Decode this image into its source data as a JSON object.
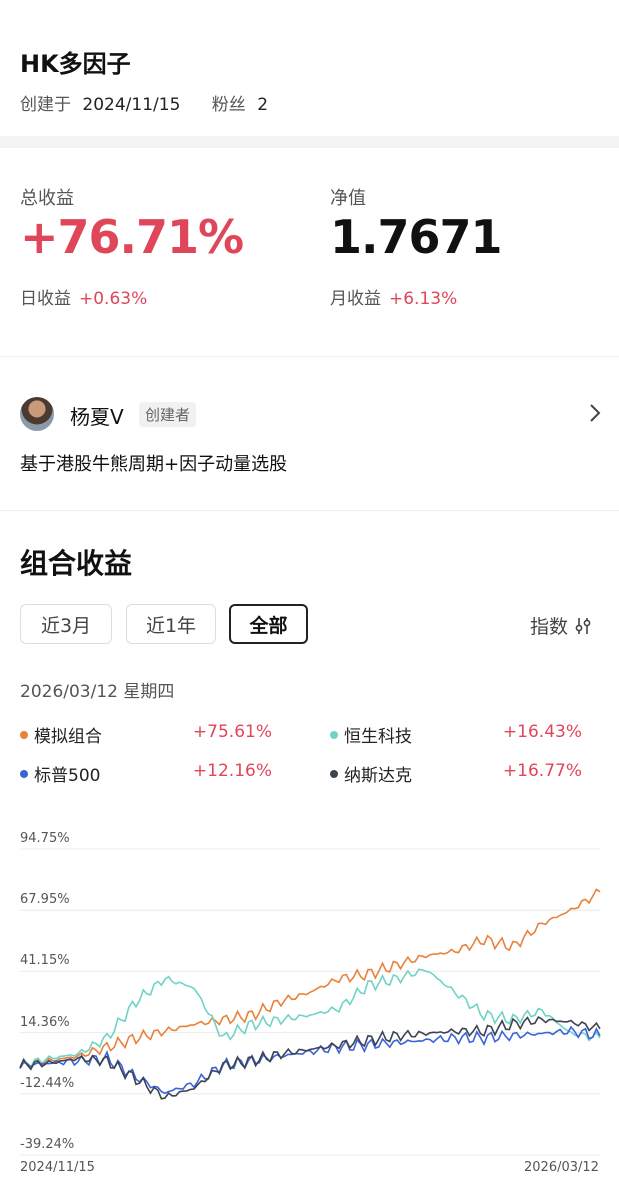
{
  "header": {
    "title": "HK多因子",
    "created_label": "创建于",
    "created_date": "2024/11/15",
    "fans_label": "粉丝",
    "fans_count": "2"
  },
  "stats": {
    "total_return_label": "总收益",
    "total_return": "+76.71%",
    "nav_label": "净值",
    "nav": "1.7671",
    "daily_label": "日收益",
    "daily": "+0.63%",
    "monthly_label": "月收益",
    "monthly": "+6.13%"
  },
  "creator": {
    "name": "杨夏V",
    "role_badge": "创建者",
    "description": "基于港股牛熊周期+因子动量选股"
  },
  "section": {
    "title": "组合收益",
    "tabs": [
      {
        "label": "近3月",
        "active": false
      },
      {
        "label": "近1年",
        "active": false
      },
      {
        "label": "全部",
        "active": true
      }
    ],
    "index_button": "指数",
    "selected_date": "2026/03/12 星期四"
  },
  "legend": [
    {
      "name": "模拟组合",
      "value": "+75.61%",
      "color": "#e8823a"
    },
    {
      "name": "恒生科技",
      "value": "+16.43%",
      "color": "#6fd3c6"
    },
    {
      "name": "标普500",
      "value": "+12.16%",
      "color": "#3a64d8"
    },
    {
      "name": "纳斯达克",
      "value": "+16.77%",
      "color": "#3d4350"
    }
  ],
  "chart_data": {
    "type": "line",
    "y_ticks": [
      "94.75%",
      "67.95%",
      "41.15%",
      "14.36%",
      "-12.44%",
      "-39.24%"
    ],
    "ylim": [
      -39.24,
      94.75
    ],
    "x_ticks": [
      "2024/11/15",
      "2026/03/12"
    ],
    "grid": true,
    "series": [
      {
        "name": "模拟组合",
        "color": "#e8823a",
        "x": [
          0,
          5,
          10,
          15,
          20,
          25,
          30,
          35,
          40,
          45,
          50,
          55,
          60,
          65,
          70,
          75,
          80,
          85,
          90,
          95,
          100
        ],
        "values": [
          0,
          2,
          4,
          8,
          12,
          15,
          18,
          20,
          22,
          28,
          32,
          38,
          40,
          44,
          48,
          50,
          55,
          52,
          62,
          68,
          76
        ]
      },
      {
        "name": "恒生科技",
        "color": "#6fd3c6",
        "x": [
          0,
          5,
          10,
          15,
          20,
          25,
          30,
          35,
          40,
          45,
          50,
          55,
          60,
          65,
          70,
          75,
          80,
          85,
          90,
          95,
          100
        ],
        "values": [
          0,
          3,
          5,
          12,
          28,
          38,
          34,
          12,
          18,
          20,
          22,
          25,
          35,
          38,
          42,
          32,
          22,
          20,
          24,
          14,
          12
        ]
      },
      {
        "name": "标普500",
        "color": "#3a64d8",
        "x": [
          0,
          5,
          10,
          15,
          20,
          25,
          30,
          35,
          40,
          45,
          50,
          55,
          60,
          65,
          70,
          75,
          80,
          85,
          90,
          95,
          100
        ],
        "values": [
          0,
          1,
          2,
          3,
          -5,
          -12,
          -8,
          0,
          2,
          4,
          6,
          8,
          9,
          10,
          11,
          12,
          12,
          13,
          14,
          15,
          13
        ]
      },
      {
        "name": "纳斯达克",
        "color": "#3d4350",
        "x": [
          0,
          5,
          10,
          15,
          20,
          25,
          30,
          35,
          40,
          45,
          50,
          55,
          60,
          65,
          70,
          75,
          80,
          85,
          90,
          95,
          100
        ],
        "values": [
          0,
          1,
          3,
          2,
          -6,
          -14,
          -10,
          0,
          2,
          5,
          7,
          9,
          11,
          13,
          14,
          15,
          15,
          18,
          20,
          19,
          16
        ]
      }
    ]
  }
}
